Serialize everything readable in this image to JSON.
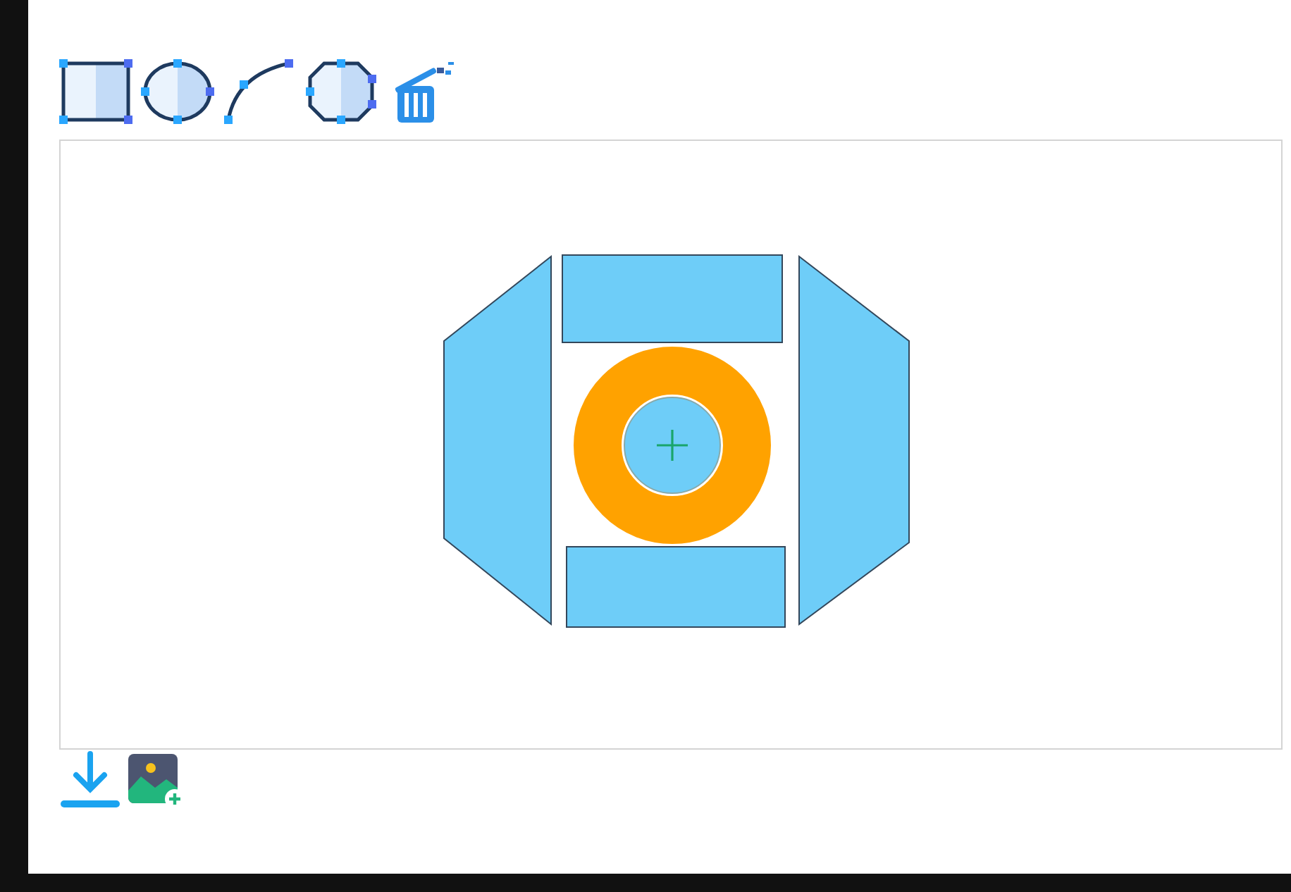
{
  "toolbar": {
    "tools": [
      {
        "kind": "rectangle"
      },
      {
        "kind": "ellipse"
      },
      {
        "kind": "curve"
      },
      {
        "kind": "polygon"
      },
      {
        "kind": "clear"
      }
    ]
  },
  "canvas": {
    "shapes": [
      {
        "kind": "polygon"
      },
      {
        "kind": "rectangle"
      },
      {
        "kind": "polygon"
      },
      {
        "kind": "rectangle"
      },
      {
        "kind": "ring"
      }
    ]
  },
  "bottom_toolbar": {
    "tools": [
      {
        "kind": "download"
      },
      {
        "kind": "add-image"
      }
    ]
  }
}
